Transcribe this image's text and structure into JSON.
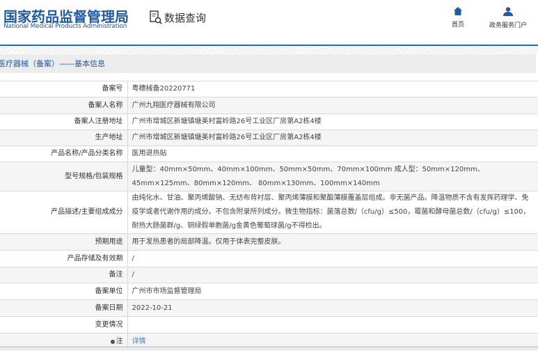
{
  "header": {
    "logo_cn": "国家药品监督管理局",
    "logo_en": "National Medical Products Administration",
    "query_title": "数据查询",
    "nav": [
      {
        "label": "首页",
        "icon": "home-icon"
      },
      {
        "label": "政务服务门户",
        "icon": "user-icon"
      }
    ]
  },
  "page_title": "医疗器械（备案）——基本信息",
  "rows": [
    {
      "label": "备案号",
      "value": "粤穗械备20220771"
    },
    {
      "label": "备案人名称",
      "value": "广州九翔医疗器械有限公司"
    },
    {
      "label": "备案人注册地址",
      "value": "广州市增城区新塘镇塘美村富岭路26号工业区厂房第A2栋4楼"
    },
    {
      "label": "生产地址",
      "value": "广州市增城区新塘镇塘美村富岭路26号工业区厂房第A2栋4楼"
    },
    {
      "label": "产品名称/产品分类名称",
      "value": "医用退热贴"
    },
    {
      "label": "型号规格/包装规格",
      "value": "儿童型：40mm×50mm、40mm×100mm、50mm×50mm、70mm×100mm 成人型：50mm×120mm、45mm×125mm、80mm×120mm、 80mm×130mm、100mm×140mm"
    },
    {
      "label": "产品描述/主要组成成分",
      "value": "由纯化水、甘油、聚丙烯酸钠、无纺布背衬层、聚丙烯薄膜和聚酯薄膜覆盖层组成。非无菌产品。降温物质不含有发挥药理学、免疫学或者代谢作用的成分。不包含附录所列成分。微生物指标：菌落总数/（cfu/g）≤500，霉菌和酵母菌总数/（cfu/g）≤100，耐热大肠菌群/g、铜绿假单胞菌/g金黄色葡萄球菌/g不得检出。"
    },
    {
      "label": "预期用途",
      "value": "用于发热患者的局部降温。仅用于体表完整皮肤。"
    },
    {
      "label": "产品存储及有效期",
      "value": "/"
    },
    {
      "label": "备注",
      "value": "/"
    },
    {
      "label": "备案单位",
      "value": "广州市市场监督管理局"
    },
    {
      "label": "备案日期",
      "value": "2022-10-21"
    },
    {
      "label": "变更情况",
      "value": ""
    },
    {
      "label": "注",
      "value": "详情"
    }
  ]
}
